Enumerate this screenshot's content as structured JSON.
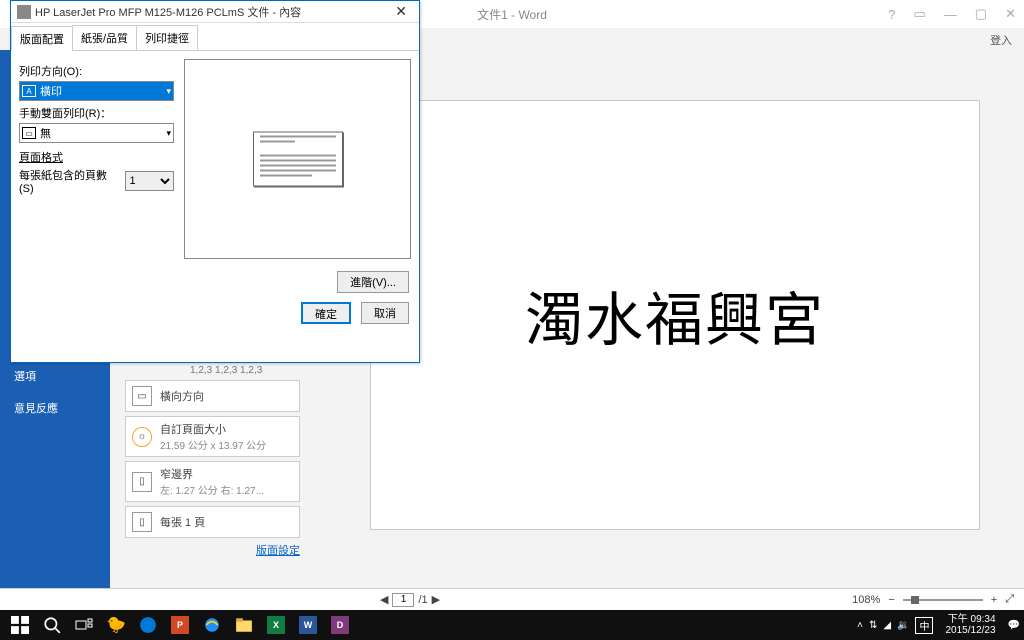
{
  "word": {
    "title": "文件1 - Word",
    "login": "登入",
    "doc_text": "濁水福興宮",
    "page_input": "1",
    "page_total": "/1",
    "zoom": "108%"
  },
  "backstage": {
    "items": [
      "選項",
      "意見反應"
    ],
    "print_pages_hint": "1,2,3   1,2,3   1,2,3",
    "print_items": [
      {
        "title": "橫向方向",
        "sub": ""
      },
      {
        "title": "自訂頁面大小",
        "sub": "21.59 公分 x 13.97 公分"
      },
      {
        "title": "窄邊界",
        "sub": "左: 1.27 公分   右: 1.27..."
      },
      {
        "title": "每張 1 頁",
        "sub": ""
      }
    ],
    "page_setup_link": "版面設定"
  },
  "dialog": {
    "title": "HP LaserJet Pro MFP M125-M126 PCLmS 文件 - 內容",
    "tabs": [
      "版面配置",
      "紙張/品質",
      "列印捷徑"
    ],
    "orientation_label": "列印方向(O):",
    "orientation_value": "橫印",
    "duplex_label": "手動雙面列印(R)：",
    "duplex_value": "無",
    "page_format_label": "頁面格式",
    "pages_per_sheet_label": "每張紙包含的頁數(S)",
    "pages_per_sheet_value": "1",
    "advanced": "進階(V)...",
    "ok": "確定",
    "cancel": "取消"
  },
  "taskbar": {
    "ime": "中",
    "time": "下午 09:34",
    "date": "2015/12/23"
  }
}
